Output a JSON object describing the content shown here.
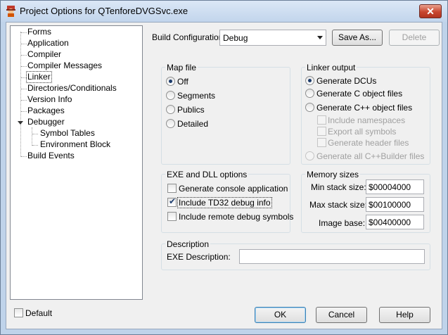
{
  "window": {
    "title": "Project Options for QTenforeDVGSvc.exe",
    "close_glyph": "✕"
  },
  "tree": {
    "items": [
      "Forms",
      "Application",
      "Compiler",
      "Compiler Messages",
      "Linker",
      "Directories/Conditionals",
      "Version Info",
      "Packages",
      "Debugger"
    ],
    "debugger_children": [
      "Symbol Tables",
      "Environment Block"
    ],
    "last": "Build Events"
  },
  "build_config": {
    "label": "Build Configuration",
    "value": "Debug",
    "save_as": "Save As...",
    "delete": "Delete"
  },
  "map_file": {
    "title": "Map file",
    "options": [
      "Off",
      "Segments",
      "Publics",
      "Detailed"
    ]
  },
  "linker_output": {
    "title": "Linker output",
    "options": [
      "Generate DCUs",
      "Generate C object files",
      "Generate C++ object files"
    ],
    "sub_checks": [
      "Include namespaces",
      "Export all symbols",
      "Generate header files"
    ],
    "all_option": "Generate all C++Builder files"
  },
  "exe_dll": {
    "title": "EXE and DLL options",
    "checks": [
      "Generate console application",
      "Include TD32 debug info",
      "Include remote debug symbols"
    ]
  },
  "memory": {
    "title": "Memory sizes",
    "min_label": "Min stack size:",
    "min_value": "$00004000",
    "max_label": "Max stack size:",
    "max_value": "$00100000",
    "base_label": "Image base:",
    "base_value": "$00400000"
  },
  "description": {
    "title": "Description",
    "label": "EXE Description:",
    "value": ""
  },
  "footer": {
    "default_label": "Default",
    "ok": "OK",
    "cancel": "Cancel",
    "help": "Help"
  }
}
